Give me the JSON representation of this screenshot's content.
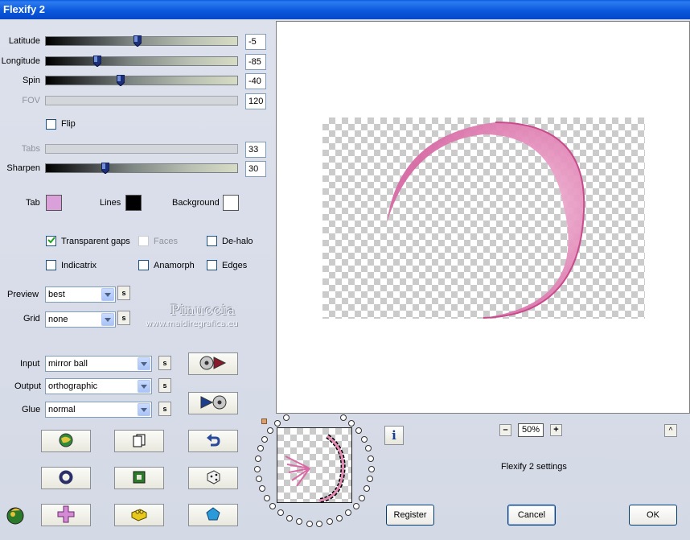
{
  "window": {
    "title": "Flexify 2"
  },
  "sliders": [
    {
      "label": "Latitude",
      "value": "-5",
      "level": 0.48,
      "enabled": true
    },
    {
      "label": "Longitude",
      "value": "-85",
      "level": 0.27,
      "enabled": true
    },
    {
      "label": "Spin",
      "value": "-40",
      "level": 0.39,
      "enabled": true
    },
    {
      "label": "FOV",
      "value": "120",
      "enabled": false
    },
    {
      "label": "Tabs",
      "value": "33",
      "enabled": false
    },
    {
      "label": "Sharpen",
      "value": "30",
      "level": 0.31,
      "enabled": true
    }
  ],
  "flip": {
    "label": "Flip",
    "checked": false
  },
  "colors": {
    "tab": {
      "label": "Tab",
      "color": "#d9a0d9"
    },
    "lines": {
      "label": "Lines",
      "color": "#000000"
    },
    "background": {
      "label": "Background",
      "color": "#ffffff"
    }
  },
  "options": [
    {
      "label": "Transparent gaps",
      "checked": true,
      "enabled": true
    },
    {
      "label": "Faces",
      "checked": false,
      "enabled": false
    },
    {
      "label": "De-halo",
      "checked": false,
      "enabled": true
    },
    {
      "label": "Indicatrix",
      "checked": false,
      "enabled": true
    },
    {
      "label": "Anamorph",
      "checked": false,
      "enabled": true
    },
    {
      "label": "Edges",
      "checked": false,
      "enabled": true
    }
  ],
  "preview_select": {
    "label": "Preview",
    "value": "best",
    "s_label": "s"
  },
  "grid_select": {
    "label": "Grid",
    "value": "none",
    "s_label": "s"
  },
  "watermark": {
    "name": "Pinuccia",
    "url": "www.maidiregrafica.eu"
  },
  "input_select": {
    "label": "Input",
    "value": "mirror ball",
    "s_label": "s"
  },
  "output_select": {
    "label": "Output",
    "value": "orthographic",
    "s_label": "s"
  },
  "glue_select": {
    "label": "Glue",
    "value": "normal",
    "s_label": "s"
  },
  "zoom": {
    "minus": "–",
    "value": "50%",
    "plus": "+"
  },
  "collapse_label": "^",
  "info_label": "i",
  "settings_name": "Flexify 2 settings",
  "buttons": {
    "register": "Register",
    "cancel": "Cancel",
    "ok": "OK"
  },
  "accent": {
    "preview_pink": "#d86aa5",
    "titlebar": "#0a5ae0"
  }
}
